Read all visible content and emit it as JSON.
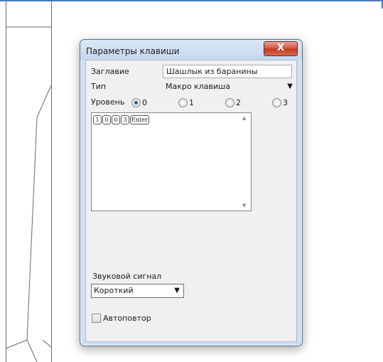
{
  "dialog": {
    "title": "Параметры клавиши",
    "close_glyph": "X",
    "caption_label": "Заглавие",
    "caption_value": "Шашлык из баранины",
    "type_label": "Тип",
    "type_value": "Макро клавиша",
    "level_label": "Уровень",
    "level_options": [
      "0",
      "1",
      "2",
      "3"
    ],
    "level_selected": "0",
    "macro_keys": [
      "1",
      "0",
      "0",
      "3",
      "Enter"
    ],
    "sound_label": "Звуковой сигнал",
    "sound_value": "Короткий",
    "repeat_label": "Автоповтор",
    "repeat_checked": false
  },
  "colors": {
    "window_frame": "#cfe0f3",
    "close_button": "#c13a22",
    "canvas_border": "#4a7ab7",
    "radio_selected": "#1d5ea8"
  },
  "icons": {
    "close": "close-icon",
    "dropdown": "chevron-down-icon",
    "scroll_up": "scroll-up-icon",
    "scroll_down": "scroll-down-icon"
  }
}
